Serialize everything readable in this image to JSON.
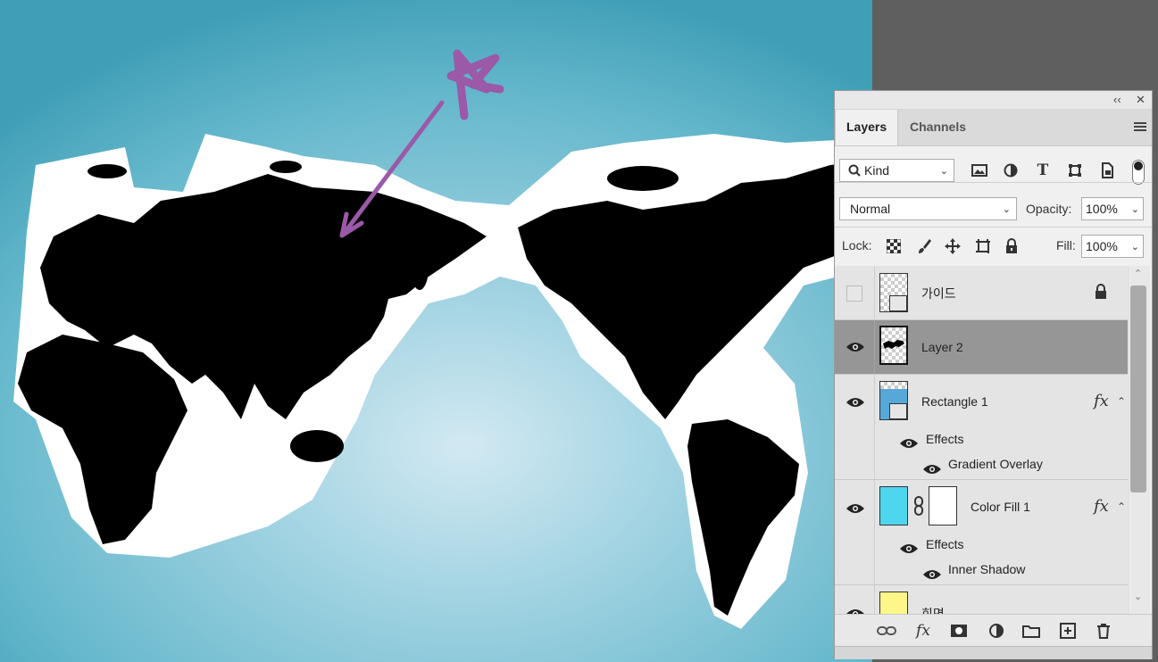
{
  "panel": {
    "collapse_glyph": "‹‹",
    "close_glyph": "✕",
    "tabs": [
      {
        "label": "Layers",
        "active": true
      },
      {
        "label": "Channels",
        "active": false
      }
    ],
    "filter": {
      "label": "Kind"
    },
    "blend": {
      "mode": "Normal",
      "opacity_label": "Opacity:",
      "opacity": "100%"
    },
    "lock": {
      "label": "Lock:",
      "fill_label": "Fill:",
      "fill": "100%"
    },
    "layers": [
      {
        "name": "가이드",
        "visible": false,
        "locked": true
      },
      {
        "name": "Layer 2",
        "visible": true,
        "selected": true
      },
      {
        "name": "Rectangle 1",
        "visible": true,
        "fx": "fx",
        "effects_label": "Effects",
        "effect": "Gradient Overlay"
      },
      {
        "name": "Color Fill 1",
        "visible": true,
        "fx": "fx",
        "effects_label": "Effects",
        "effect": "Inner Shadow",
        "fill_color": "#4fd6ef"
      },
      {
        "name": "회면",
        "visible": true
      }
    ]
  },
  "colors": {
    "annotation": "#9b59a8",
    "gradient_center": "#d2e9f2",
    "gradient_edge": "#3f9fb7",
    "color_fill": "#4fd6ef"
  },
  "icons": [
    "search-icon",
    "image-filter-icon",
    "adjustment-filter-icon",
    "type-filter-icon",
    "shape-filter-icon",
    "smart-object-filter-icon",
    "filter-toggle",
    "lock-pixels-icon",
    "lock-brush-icon",
    "lock-position-icon",
    "lock-artboard-icon",
    "lock-all-icon",
    "eye-icon",
    "link-icon",
    "fx-icon",
    "mask-icon",
    "adjustment-icon",
    "folder-icon",
    "new-layer-icon",
    "trash-icon"
  ]
}
